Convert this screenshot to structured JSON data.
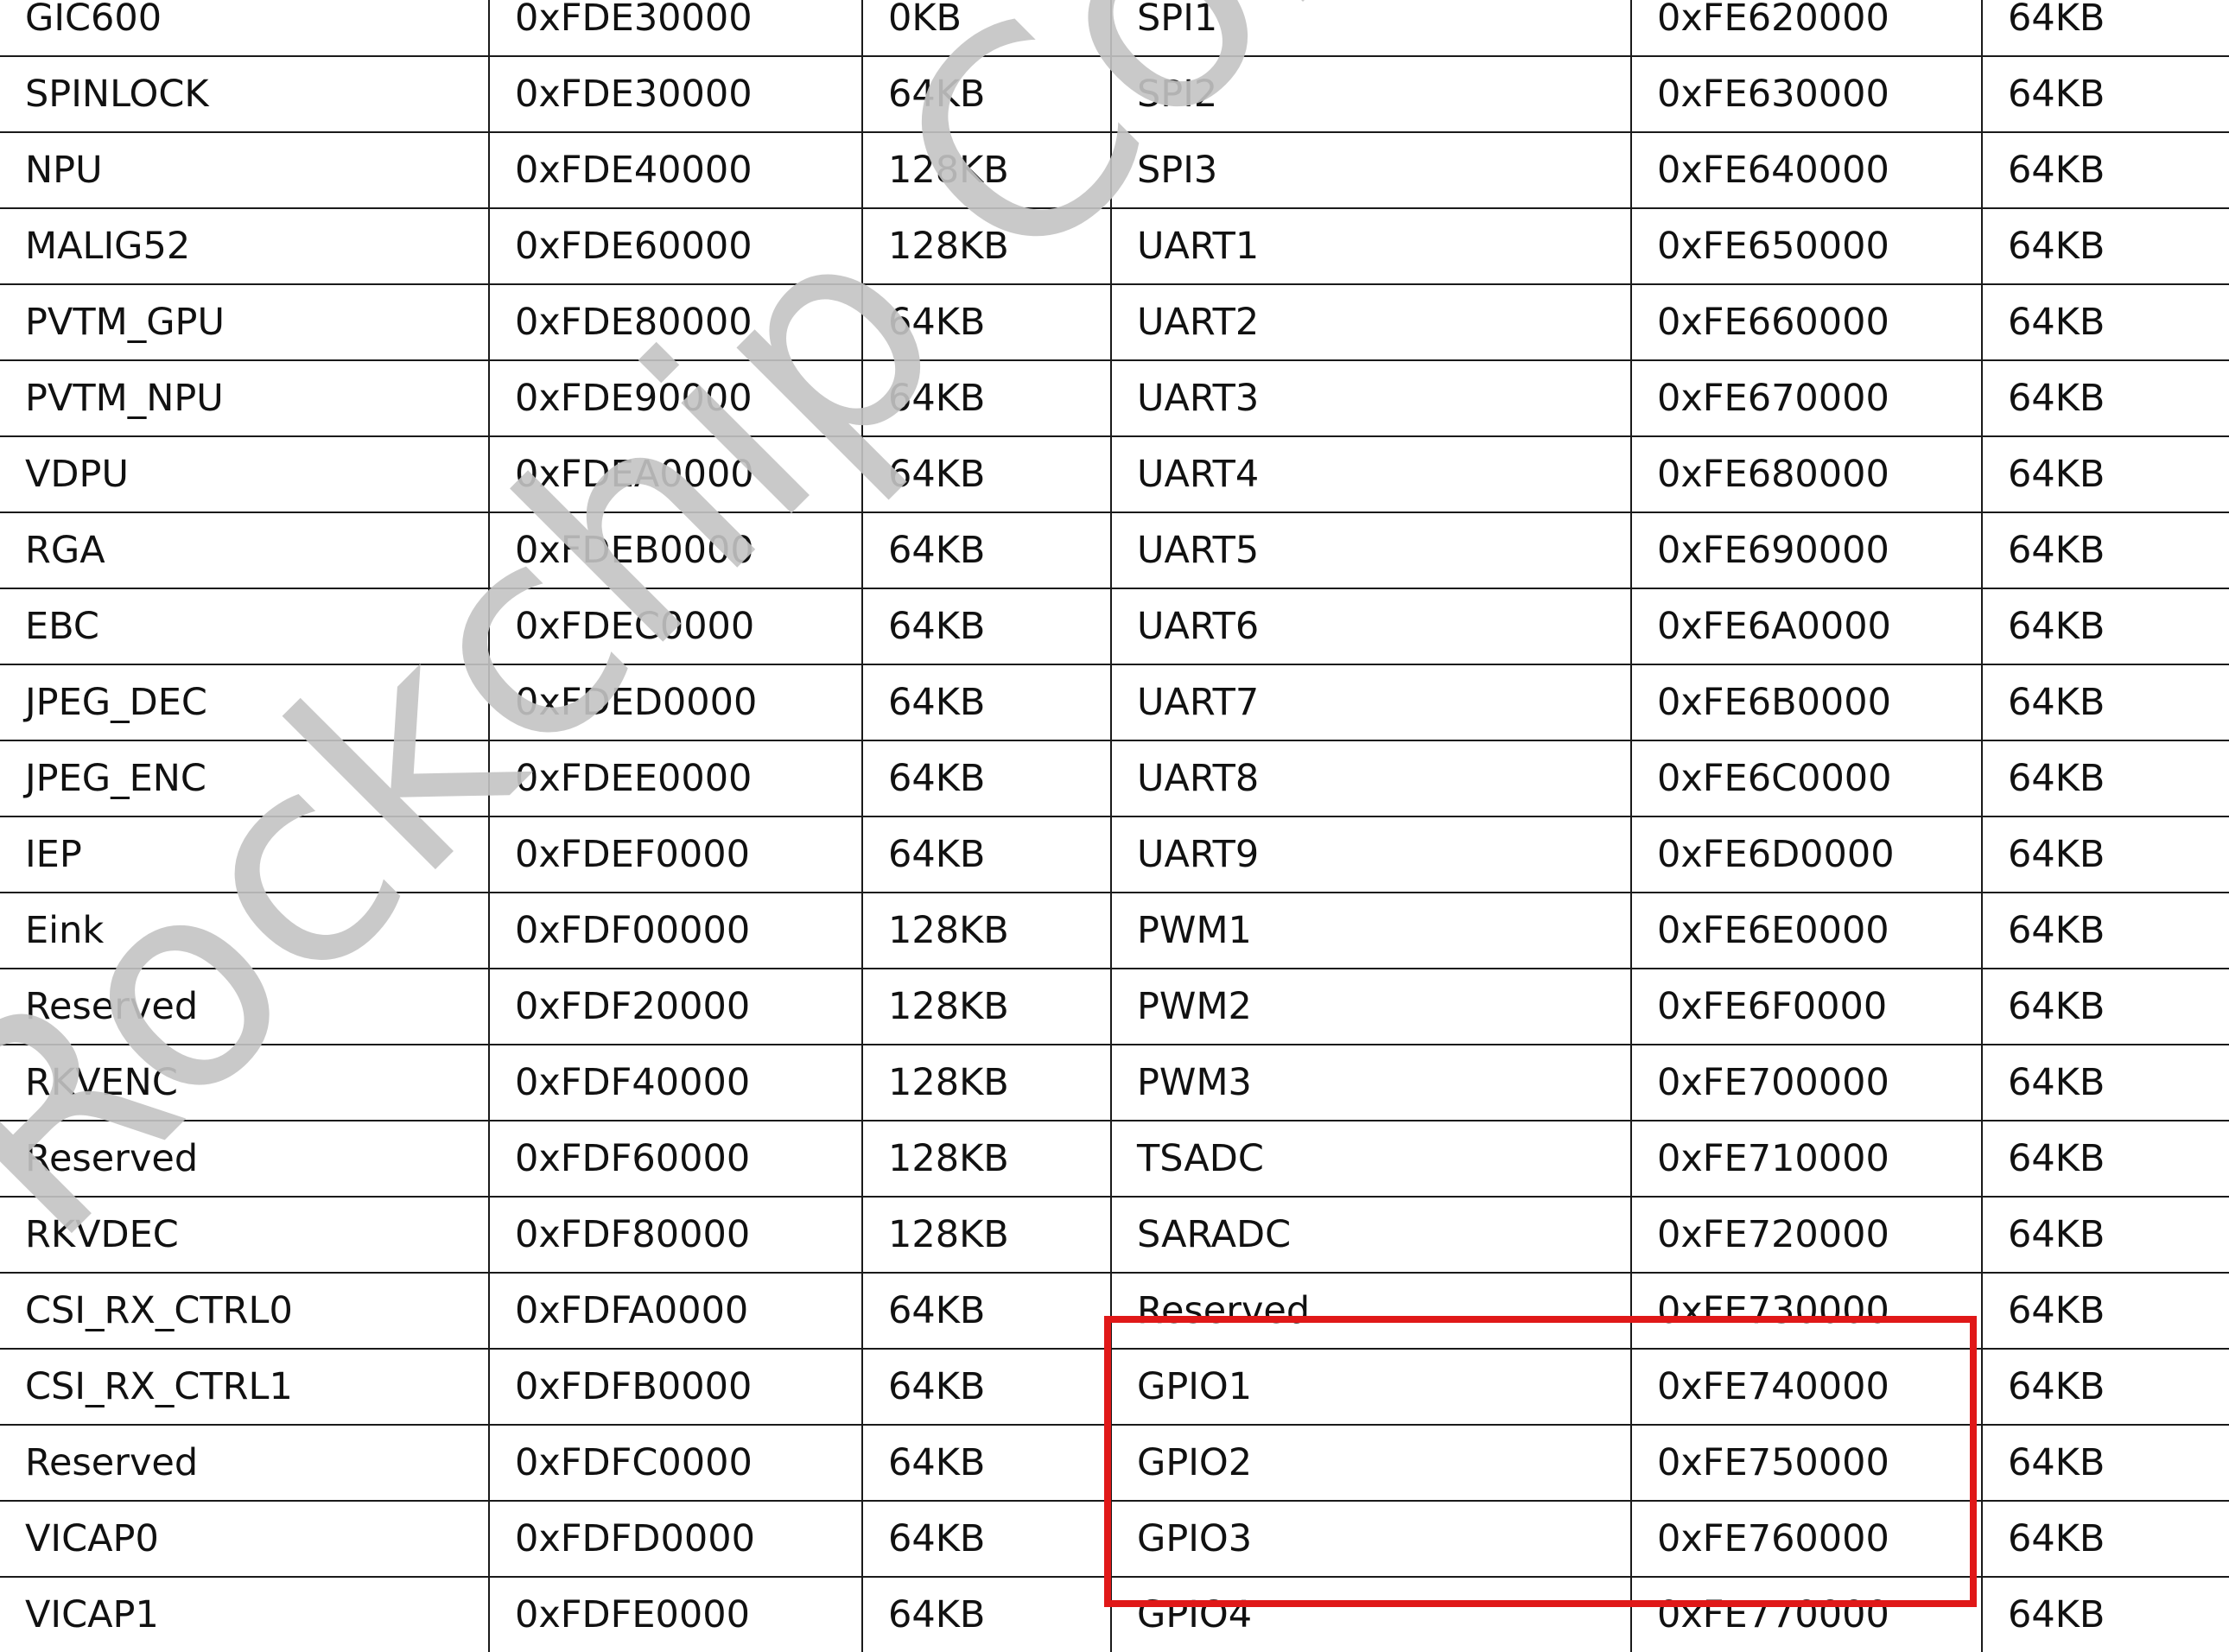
{
  "table": {
    "rows": [
      {
        "left_name": "GIC600",
        "left_addr": "0xFDE30000",
        "left_size": "0KB",
        "right_name": "SPI1",
        "right_addr": "0xFE620000",
        "right_size": "64KB"
      },
      {
        "left_name": "SPINLOCK",
        "left_addr": "0xFDE30000",
        "left_size": "64KB",
        "right_name": "SPI2",
        "right_addr": "0xFE630000",
        "right_size": "64KB"
      },
      {
        "left_name": "NPU",
        "left_addr": "0xFDE40000",
        "left_size": "128KB",
        "right_name": "SPI3",
        "right_addr": "0xFE640000",
        "right_size": "64KB"
      },
      {
        "left_name": "MALIG52",
        "left_addr": "0xFDE60000",
        "left_size": "128KB",
        "right_name": "UART1",
        "right_addr": "0xFE650000",
        "right_size": "64KB"
      },
      {
        "left_name": "PVTM_GPU",
        "left_addr": "0xFDE80000",
        "left_size": "64KB",
        "right_name": "UART2",
        "right_addr": "0xFE660000",
        "right_size": "64KB"
      },
      {
        "left_name": "PVTM_NPU",
        "left_addr": "0xFDE90000",
        "left_size": "64KB",
        "right_name": "UART3",
        "right_addr": "0xFE670000",
        "right_size": "64KB"
      },
      {
        "left_name": "VDPU",
        "left_addr": "0xFDEA0000",
        "left_size": "64KB",
        "right_name": "UART4",
        "right_addr": "0xFE680000",
        "right_size": "64KB"
      },
      {
        "left_name": "RGA",
        "left_addr": "0xFDEB0000",
        "left_size": "64KB",
        "right_name": "UART5",
        "right_addr": "0xFE690000",
        "right_size": "64KB"
      },
      {
        "left_name": "EBC",
        "left_addr": "0xFDEC0000",
        "left_size": "64KB",
        "right_name": "UART6",
        "right_addr": "0xFE6A0000",
        "right_size": "64KB"
      },
      {
        "left_name": "JPEG_DEC",
        "left_addr": "0xFDED0000",
        "left_size": "64KB",
        "right_name": "UART7",
        "right_addr": "0xFE6B0000",
        "right_size": "64KB"
      },
      {
        "left_name": "JPEG_ENC",
        "left_addr": "0xFDEE0000",
        "left_size": "64KB",
        "right_name": "UART8",
        "right_addr": "0xFE6C0000",
        "right_size": "64KB"
      },
      {
        "left_name": "IEP",
        "left_addr": "0xFDEF0000",
        "left_size": "64KB",
        "right_name": "UART9",
        "right_addr": "0xFE6D0000",
        "right_size": "64KB"
      },
      {
        "left_name": "Eink",
        "left_addr": "0xFDF00000",
        "left_size": "128KB",
        "right_name": "PWM1",
        "right_addr": "0xFE6E0000",
        "right_size": "64KB"
      },
      {
        "left_name": "Reserved",
        "left_addr": "0xFDF20000",
        "left_size": "128KB",
        "right_name": "PWM2",
        "right_addr": "0xFE6F0000",
        "right_size": "64KB"
      },
      {
        "left_name": "RKVENC",
        "left_addr": "0xFDF40000",
        "left_size": "128KB",
        "right_name": "PWM3",
        "right_addr": "0xFE700000",
        "right_size": "64KB"
      },
      {
        "left_name": "Reserved",
        "left_addr": "0xFDF60000",
        "left_size": "128KB",
        "right_name": "TSADC",
        "right_addr": "0xFE710000",
        "right_size": "64KB"
      },
      {
        "left_name": "RKVDEC",
        "left_addr": "0xFDF80000",
        "left_size": "128KB",
        "right_name": "SARADC",
        "right_addr": "0xFE720000",
        "right_size": "64KB"
      },
      {
        "left_name": "CSI_RX_CTRL0",
        "left_addr": "0xFDFA0000",
        "left_size": "64KB",
        "right_name": "Reserved",
        "right_addr": "0xFE730000",
        "right_size": "64KB"
      },
      {
        "left_name": "CSI_RX_CTRL1",
        "left_addr": "0xFDFB0000",
        "left_size": "64KB",
        "right_name": "GPIO1",
        "right_addr": "0xFE740000",
        "right_size": "64KB"
      },
      {
        "left_name": "Reserved",
        "left_addr": "0xFDFC0000",
        "left_size": "64KB",
        "right_name": "GPIO2",
        "right_addr": "0xFE750000",
        "right_size": "64KB"
      },
      {
        "left_name": "VICAP0",
        "left_addr": "0xFDFD0000",
        "left_size": "64KB",
        "right_name": "GPIO3",
        "right_addr": "0xFE760000",
        "right_size": "64KB"
      },
      {
        "left_name": "VICAP1",
        "left_addr": "0xFDFE0000",
        "left_size": "64KB",
        "right_name": "GPIO4",
        "right_addr": "0xFE770000",
        "right_size": "64KB"
      }
    ]
  },
  "watermark": {
    "text": "Rockchip Confidential",
    "color": "#c4c4c4"
  },
  "highlight": {
    "color": "#e01818",
    "rows": [
      "GPIO1",
      "GPIO2",
      "GPIO3",
      "GPIO4"
    ]
  }
}
